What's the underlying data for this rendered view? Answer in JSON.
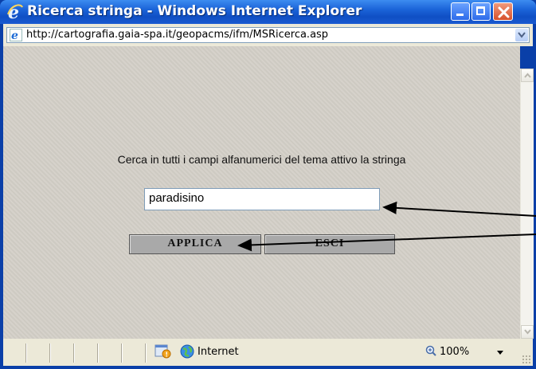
{
  "window": {
    "title": "Ricerca stringa - Windows Internet Explorer",
    "controls": [
      "minimize",
      "maximize",
      "close"
    ]
  },
  "address_bar": {
    "url": "http://cartografia.gaia-spa.it/geopacms/ifm/MSRicerca.asp",
    "page_icon": "ie-page-icon"
  },
  "form": {
    "prompt": "Cerca in tutti i campi alfanumerici del tema attivo la stringa",
    "search_value": "paradisino",
    "apply_label": "APPLICA",
    "exit_label": "ESCI"
  },
  "status_bar": {
    "zone": "Internet",
    "zoom": "100%"
  },
  "colors": {
    "titlebar": "#1b63d8",
    "content_bg": "#d4d0c8",
    "button_bg": "#a9a9a9",
    "close_button": "#d6502b"
  }
}
